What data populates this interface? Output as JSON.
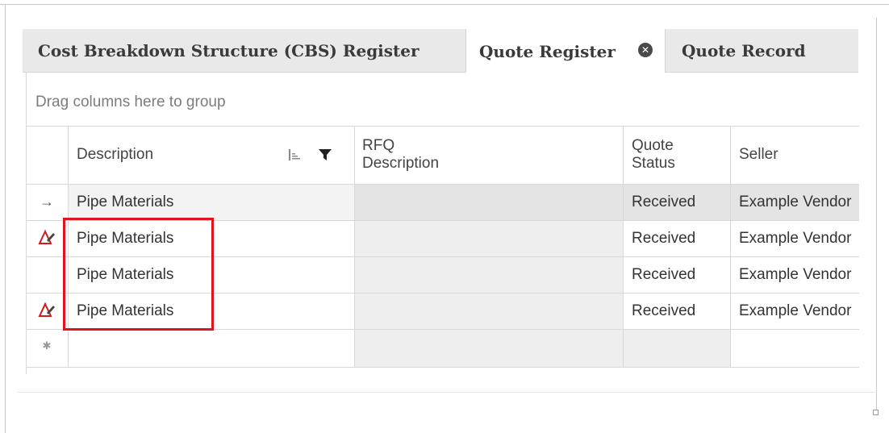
{
  "tabs": [
    {
      "label": "Cost Breakdown Structure (CBS) Register"
    },
    {
      "label": "Quote Register"
    },
    {
      "label": "Quote Record"
    }
  ],
  "group_panel": {
    "text": "Drag columns here to group"
  },
  "columns": [
    {
      "label": "Description"
    },
    {
      "label_line1": "RFQ",
      "label_line2": "Description"
    },
    {
      "label_line1": "Quote",
      "label_line2": "Status"
    },
    {
      "label": "Seller"
    }
  ],
  "rows": [
    {
      "indicator": "current-row-arrow",
      "description": "Pipe Materials",
      "rfq_description": "",
      "status": "Received",
      "seller": "Example Vendor"
    },
    {
      "indicator": "edited-row-pencil",
      "description": "Pipe Materials",
      "rfq_description": "",
      "status": "Received",
      "seller": "Example Vendor"
    },
    {
      "indicator": "none",
      "description": "Pipe Materials",
      "rfq_description": "",
      "status": "Received",
      "seller": "Example Vendor"
    },
    {
      "indicator": "edited-row-pencil",
      "description": "Pipe Materials",
      "rfq_description": "",
      "status": "Received",
      "seller": "Example Vendor"
    }
  ],
  "new_row": {
    "indicator": "new-row-asterisk"
  },
  "glyphs": {
    "arrow": "→",
    "asterisk": "✱",
    "close": "✕"
  },
  "colors": {
    "highlight_border": "#e0141e",
    "edit_icon": "#d11a1a",
    "tab_bar": "#e9e9e9",
    "readonly_cell": "#eeeeee"
  }
}
